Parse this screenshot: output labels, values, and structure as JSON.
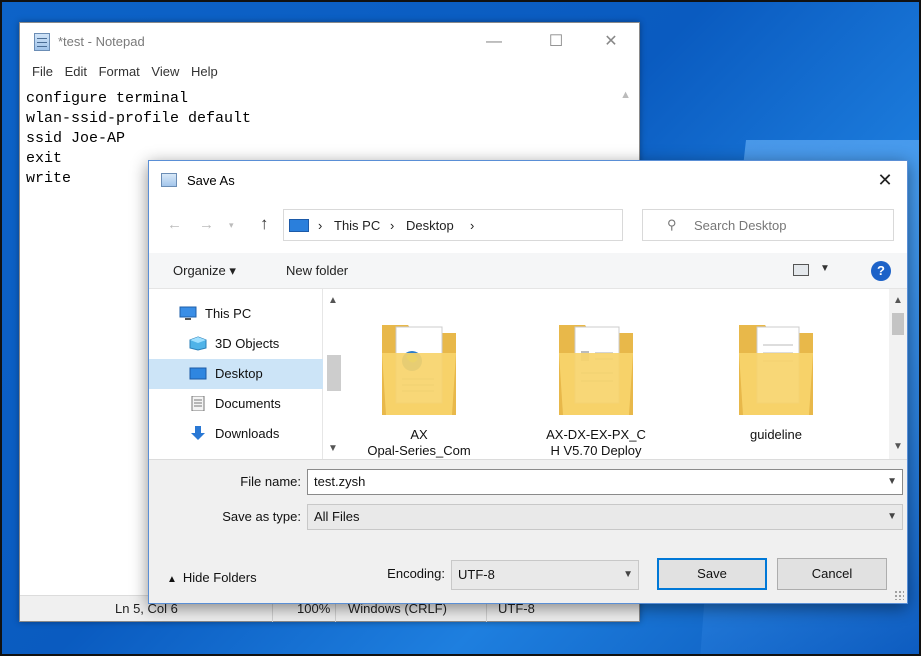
{
  "notepad": {
    "title": "*test - Notepad",
    "menu": [
      "File",
      "Edit",
      "Format",
      "View",
      "Help"
    ],
    "content": "configure terminal\nwlan-ssid-profile default\nssid Joe-AP\nexit\nwrite",
    "status": {
      "position": "Ln 5, Col 6",
      "zoom": "100%",
      "line_ending": "Windows (CRLF)",
      "encoding": "UTF-8"
    },
    "window_buttons": {
      "minimize": "—",
      "maximize": "☐",
      "close": "✕"
    }
  },
  "dialog": {
    "title": "Save As",
    "close_glyph": "✕",
    "address": {
      "crumbs": [
        "This PC",
        "Desktop"
      ],
      "separator": "›"
    },
    "search_placeholder": "Search Desktop",
    "toolbar": {
      "organize": "Organize ▾",
      "new_folder": "New folder",
      "help": "?"
    },
    "nav_items": [
      {
        "label": "This PC",
        "icon": "computer-icon"
      },
      {
        "label": "3D Objects",
        "icon": "cube-icon"
      },
      {
        "label": "Desktop",
        "icon": "desktop-icon",
        "selected": true
      },
      {
        "label": "Documents",
        "icon": "documents-icon"
      },
      {
        "label": "Downloads",
        "icon": "download-arrow-icon"
      }
    ],
    "files": [
      {
        "name_line1": "AX",
        "name_line2": "Opal-Series_Com",
        "icon": "folder-with-document-icon"
      },
      {
        "name_line1": "AX-DX-EX-PX_C",
        "name_line2": "H V5.70 Deploy",
        "icon": "folder-with-document-icon"
      },
      {
        "name_line1": "guideline",
        "name_line2": "",
        "icon": "folder-with-document-icon"
      }
    ],
    "file_name_label": "File name:",
    "file_name_value": "test.zysh",
    "save_as_type_label": "Save as type:",
    "save_as_type_value": "All Files",
    "hide_folders": "Hide Folders",
    "encoding_label": "Encoding:",
    "encoding_value": "UTF-8",
    "save_button": "Save",
    "cancel_button": "Cancel"
  },
  "colors": {
    "desktop": "#0d63c8",
    "selection": "#cce4f7",
    "primary_border": "#0078d7",
    "folder": "#f7d46b"
  }
}
